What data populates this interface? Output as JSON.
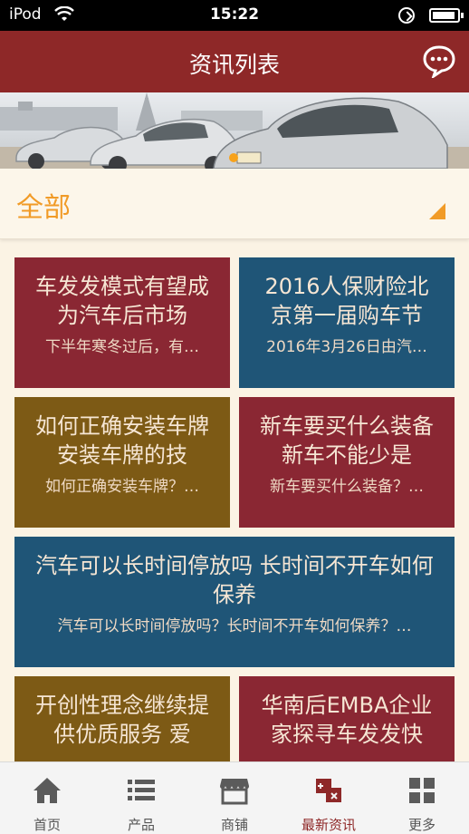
{
  "status_bar": {
    "carrier": "iPod",
    "time": "15:22"
  },
  "header": {
    "title": "资讯列表",
    "chat_icon": "chat-bubble-icon"
  },
  "filter": {
    "label": "全部",
    "dropdown_icon": "triangle-corner-icon",
    "accent": "#f19b27"
  },
  "cards": [
    {
      "title": "车发发模式有望成为汽车后市场",
      "summary": "下半年寒冬过后，有…",
      "color": "#8a2733"
    },
    {
      "title": "2016人保财险北京第一届购车节",
      "summary": "2016年3月26日由汽…",
      "color": "#1f5577"
    },
    {
      "title": "如何正确安装车牌 安装车牌的技",
      "summary": "如何正确安装车牌？…",
      "color": "#7d5a15"
    },
    {
      "title": "新车要买什么装备 新车不能少是",
      "summary": "新车要买什么装备？…",
      "color": "#8a2733"
    },
    {
      "title": "汽车可以长时间停放吗 长时间不开车如何保养",
      "summary": "汽车可以长时间停放吗？长时间不开车如何保养？…",
      "color": "#1f5577"
    },
    {
      "title": "开创性理念继续提供优质服务 爱",
      "summary": "",
      "color": "#7d5a15"
    },
    {
      "title": "华南后EMBA企业家探寻车发发快",
      "summary": "",
      "color": "#8a2733"
    }
  ],
  "tabs": [
    {
      "label": "首页",
      "icon": "home-icon"
    },
    {
      "label": "产品",
      "icon": "list-icon"
    },
    {
      "label": "商铺",
      "icon": "shop-icon"
    },
    {
      "label": "最新资讯",
      "icon": "news-icon",
      "active": true
    },
    {
      "label": "更多",
      "icon": "grid-icon"
    }
  ],
  "colors": {
    "header": "#8e2828",
    "active_tab": "#8e2828"
  }
}
